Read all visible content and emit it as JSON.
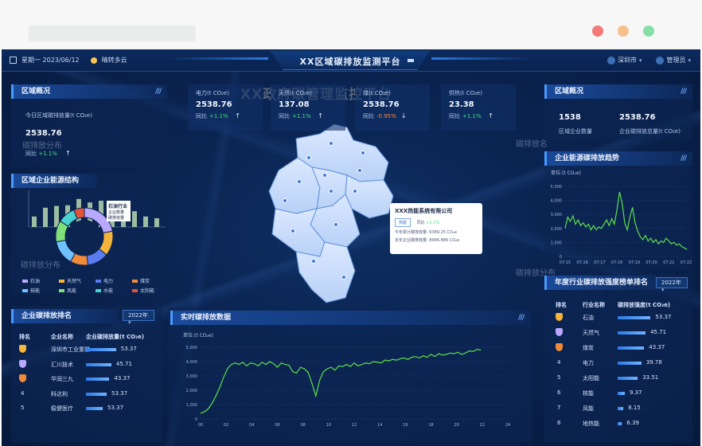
{
  "topbar": {
    "date": "星期一 2023/06/12",
    "weather": "晴转多云",
    "title": "XX区域碳排放监测平台",
    "city": "深圳市",
    "user": "管理员"
  },
  "center_watermark": "XX政府碳管理监控平台",
  "watermarks": [
    "碳排放分布",
    "碳排放分布",
    "碳排放名",
    "碳排放分布"
  ],
  "left_overview": {
    "title": "区域概况",
    "label": "今日区域碳排放量(t CO₂e)",
    "value": "2538.76",
    "yoy_label": "同比",
    "yoy_value": "+1.1%"
  },
  "energy_structure": {
    "title": "区域企业能源结构",
    "tooltip_title": "石油行业",
    "tooltip_line1": "企业数量",
    "tooltip_line2": "碳排放量",
    "legend": [
      {
        "name": "石油",
        "color": "#b8a8ff"
      },
      {
        "name": "天然气",
        "color": "#f5b53b"
      },
      {
        "name": "电力",
        "color": "#5a7cf0"
      },
      {
        "name": "煤炭",
        "color": "#f08a3a"
      },
      {
        "name": "核能",
        "color": "#6fc1ff"
      },
      {
        "name": "风能",
        "color": "#7fe07a"
      },
      {
        "name": "水能",
        "color": "#4ad1d1"
      },
      {
        "name": "太阳能",
        "color": "#e0553a"
      }
    ],
    "donut_values": [
      22,
      14,
      12,
      10,
      14,
      12,
      10,
      6
    ]
  },
  "energy_bars": {
    "values": [
      30,
      55,
      60,
      62,
      80,
      70,
      75,
      58,
      65,
      45,
      30,
      25
    ]
  },
  "top_cards": [
    {
      "label": "电力(t CO₂e)",
      "value": "2538.76",
      "yoy_label": "同比",
      "yoy": "+1.1%",
      "dir": "up"
    },
    {
      "label": "天然(t CO₂e)",
      "value": "137.08",
      "yoy_label": "同比",
      "yoy": "+1.1%",
      "dir": "up"
    },
    {
      "label": "煤(t CO₂e)",
      "value": "2538.76",
      "yoy_label": "同比",
      "yoy": "-0.95%",
      "dir": "down"
    },
    {
      "label": "供热(t CO₂e)",
      "value": "23.38",
      "yoy_label": "同比",
      "yoy": "+1.1%",
      "dir": "up"
    }
  ],
  "map_tooltip": {
    "title": "XXX热能系统有限公司",
    "tag": "热能",
    "yoy_label": "同比",
    "yoy": "+1.1%",
    "line1_label": "今年累计碳排放量:",
    "line1_value": "6389.25 CO₂e",
    "line2_label": "去年企业碳排放量:",
    "line2_value": "8996.886 CO₂e"
  },
  "right_overview": {
    "title": "区域概况",
    "count_value": "1538",
    "count_label": "区域企业数量",
    "total_value": "2538.76",
    "total_label": "企业碳排放总量(t CO₂e)"
  },
  "trend": {
    "title": "企业能源碳排放趋势",
    "unit": "单位:(t CO₂e)"
  },
  "industry_rank": {
    "title": "年度行业碳排放强度榜单排名",
    "year": "2022年",
    "headers": [
      "排名",
      "行业名称",
      "碳排放强度(t CO₂e)"
    ],
    "rows": [
      {
        "rank": "1",
        "name": "石油",
        "value": "53.37",
        "pct": 0.92,
        "medal": "#f5b53b"
      },
      {
        "rank": "2",
        "name": "天然气",
        "value": "45.71",
        "pct": 0.78,
        "medal": "#b8a8ff"
      },
      {
        "rank": "3",
        "name": "煤炭",
        "value": "43.37",
        "pct": 0.74,
        "medal": "#f08a3a"
      },
      {
        "rank": "4",
        "name": "电力",
        "value": "39.78",
        "pct": 0.66,
        "medal": ""
      },
      {
        "rank": "5",
        "name": "太阳能",
        "value": "33.51",
        "pct": 0.56,
        "medal": ""
      },
      {
        "rank": "6",
        "name": "核能",
        "value": "9.37",
        "pct": 0.2,
        "medal": ""
      },
      {
        "rank": "7",
        "name": "风能",
        "value": "8.15",
        "pct": 0.16,
        "medal": ""
      },
      {
        "rank": "8",
        "name": "地热能",
        "value": "6.39",
        "pct": 0.12,
        "medal": ""
      }
    ]
  },
  "company_rank": {
    "title": "企业碳排放排名",
    "year": "2022年",
    "headers": [
      "排名",
      "企业名称",
      "企业碳排放量(t CO₂e)"
    ],
    "rows": [
      {
        "rank": "1",
        "name": "深圳市工业重联",
        "value": "53.37",
        "pct": 0.9,
        "medal": "#f5b53b"
      },
      {
        "rank": "2",
        "name": "汇川技术",
        "value": "45.71",
        "pct": 0.76,
        "medal": "#b8a8ff"
      },
      {
        "rank": "3",
        "name": "华润三九",
        "value": "43.37",
        "pct": 0.7,
        "medal": "#f08a3a"
      },
      {
        "rank": "4",
        "name": "科达利",
        "value": "53.37",
        "pct": 0.62,
        "medal": ""
      },
      {
        "rank": "5",
        "name": "稳健医疗",
        "value": "53.37",
        "pct": 0.5,
        "medal": ""
      }
    ]
  },
  "realtime": {
    "title": "实时碳排放数据",
    "unit": "单位:(t CO₂e)"
  },
  "chart_data": [
    {
      "type": "line",
      "ylim": [
        0,
        5000
      ],
      "yticks": [
        "0",
        "1,000",
        "2,000",
        "3,000",
        "4,000",
        "5,000"
      ],
      "xticks": [
        "00",
        "02",
        "04",
        "06",
        "08",
        "10",
        "12",
        "14",
        "16",
        "18",
        "20",
        "22",
        "24"
      ],
      "x": [
        0,
        0.3,
        0.6,
        0.9,
        1.2,
        1.5,
        1.8,
        2.1,
        2.4,
        2.7,
        3.0,
        3.3,
        3.6,
        3.9,
        4.2,
        4.5,
        4.8,
        5.1,
        5.4,
        5.7,
        6.0,
        6.3,
        6.6,
        6.9,
        7.2,
        7.5,
        7.8,
        8.1,
        8.4,
        8.7,
        9.0,
        9.3,
        9.6,
        9.9,
        10.2,
        10.5,
        10.8,
        11.1,
        11.4,
        11.7,
        12.0,
        12.3,
        12.6,
        12.9,
        13.2,
        13.5,
        13.8,
        14.1,
        14.4,
        14.7,
        15.0,
        15.3,
        15.6,
        15.9,
        16.2,
        16.5,
        16.8,
        17.1,
        17.4,
        17.7,
        18.0,
        18.3,
        18.6,
        18.9,
        19.2,
        19.5,
        19.8,
        20.1,
        20.4,
        20.7,
        21.0,
        21.3,
        21.6,
        21.9
      ],
      "values": [
        400,
        500,
        700,
        1100,
        1600,
        2200,
        2900,
        3500,
        3800,
        3900,
        3800,
        3950,
        3700,
        3900,
        3850,
        3700,
        3950,
        3800,
        4000,
        3850,
        3600,
        3900,
        3800,
        3750,
        3300,
        3200,
        3600,
        3500,
        3250,
        2500,
        1600,
        2700,
        3300,
        3500,
        3600,
        3400,
        3700,
        3650,
        3800,
        3650,
        3900,
        3700,
        3800,
        3900,
        3850,
        4000,
        3950,
        3900,
        4100,
        4050,
        4150,
        4100,
        4200,
        4250,
        4150,
        4300,
        4350,
        4250,
        4400,
        4300,
        4500,
        4350,
        4550,
        4450,
        4500,
        4600,
        4550,
        4650,
        4500,
        4600,
        4750,
        4700,
        4850,
        4800
      ]
    },
    {
      "type": "line",
      "ylim": [
        0,
        5000
      ],
      "yticks": [
        "0",
        "1,000",
        "2,000",
        "3,000",
        "4,000",
        "5,000"
      ],
      "xticks": [
        "07:15",
        "07:16",
        "07:17",
        "07:18",
        "07:19",
        "07:20",
        "07:21",
        "07:22"
      ],
      "x": [
        0,
        0.15,
        0.3,
        0.45,
        0.6,
        0.75,
        0.9,
        1.05,
        1.2,
        1.35,
        1.5,
        1.65,
        1.8,
        1.95,
        2.1,
        2.25,
        2.4,
        2.55,
        2.7,
        2.85,
        3.0,
        3.15,
        3.3,
        3.45,
        3.6,
        3.75,
        3.9,
        4.05,
        4.2,
        4.35,
        4.5,
        4.65,
        4.8,
        4.95,
        5.1,
        5.25,
        5.4,
        5.55,
        5.7,
        5.85,
        6.0,
        6.15,
        6.3,
        6.45,
        6.6,
        6.75,
        6.9,
        7.05
      ],
      "values": [
        2000,
        2800,
        2500,
        2900,
        2300,
        2600,
        2200,
        2400,
        2100,
        2300,
        1900,
        2200,
        1900,
        2100,
        2000,
        2300,
        2600,
        2200,
        2700,
        2300,
        3300,
        4600,
        3800,
        2400,
        1900,
        2800,
        3500,
        2400,
        1800,
        1400,
        1200,
        1500,
        1100,
        1300,
        1000,
        1200,
        900,
        1100,
        1000,
        1300,
        1100,
        900,
        1000,
        800,
        900,
        700,
        600,
        500
      ]
    }
  ]
}
